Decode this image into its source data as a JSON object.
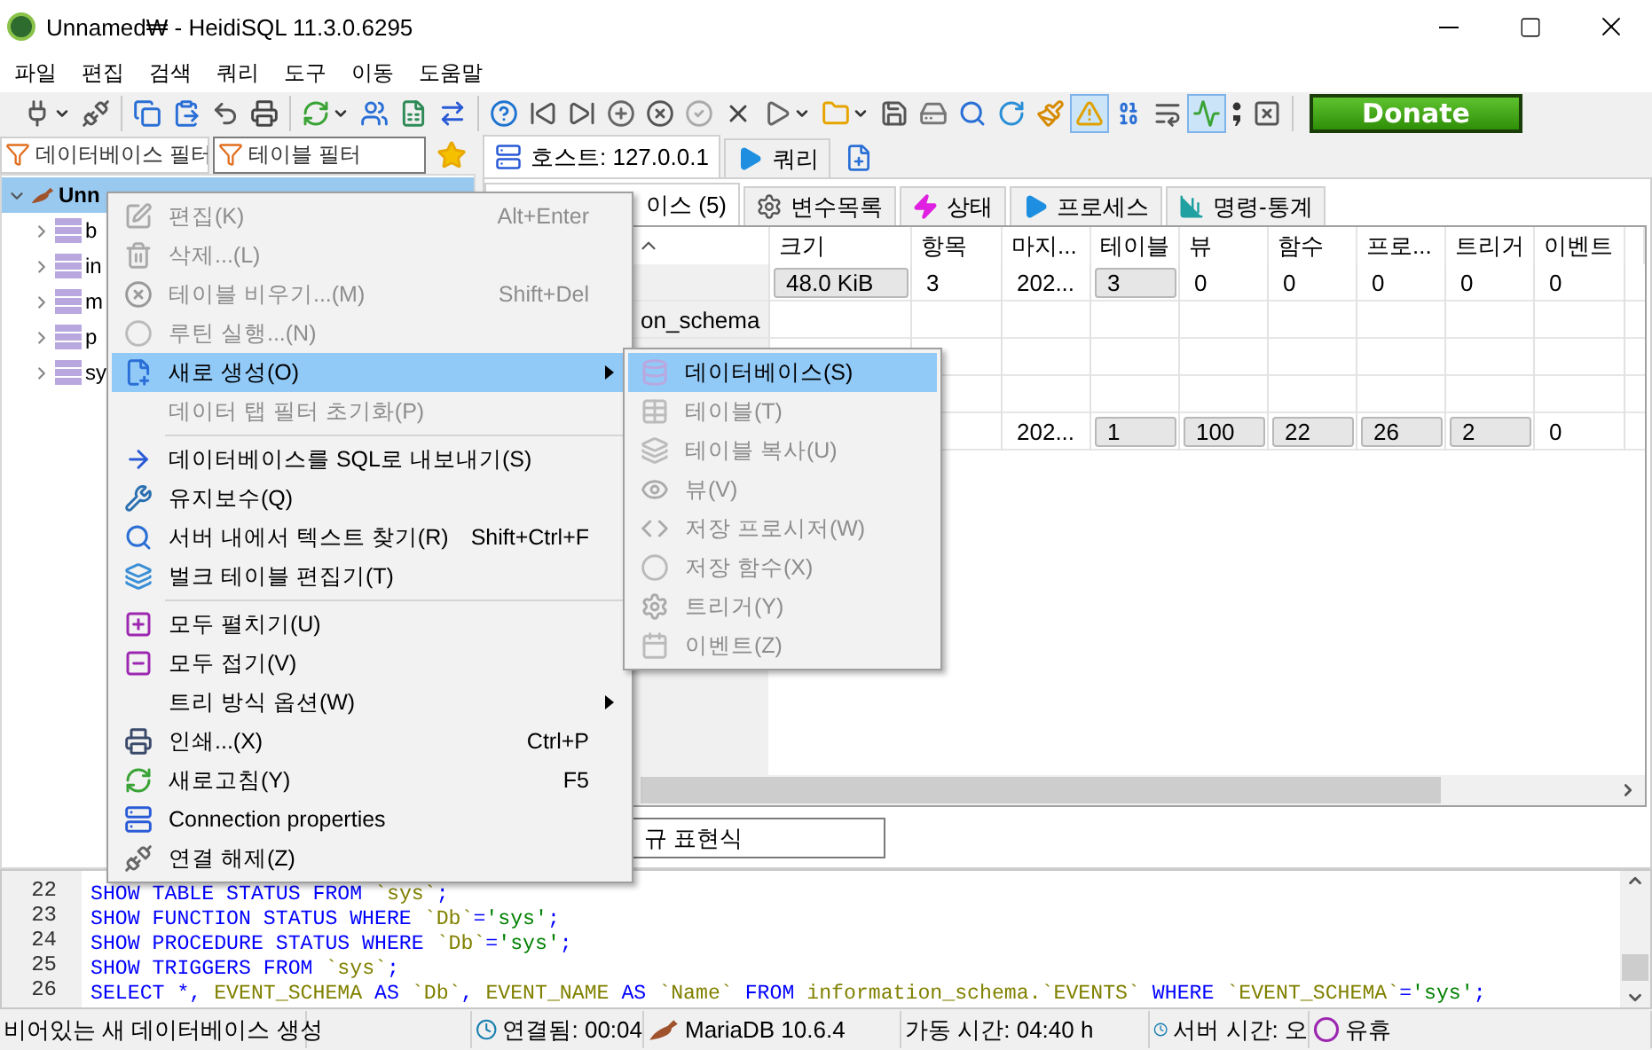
{
  "window": {
    "title": "Unnamed₩ - HeidiSQL 11.3.0.6295"
  },
  "menu_bar": [
    "파일",
    "편집",
    "검색",
    "쿼리",
    "도구",
    "이동",
    "도움말"
  ],
  "toolbar": {
    "buttons": [
      {
        "kind": "split",
        "pressed": false
      },
      {
        "kind": "button",
        "pressed": false
      },
      {
        "kind": "separator"
      },
      {
        "kind": "button",
        "pressed": false
      },
      {
        "kind": "button",
        "pressed": false
      },
      {
        "kind": "button",
        "pressed": false
      },
      {
        "kind": "button",
        "pressed": false
      },
      {
        "kind": "separator"
      },
      {
        "kind": "split",
        "pressed": false
      },
      {
        "kind": "button",
        "pressed": false
      },
      {
        "kind": "button",
        "pressed": false
      },
      {
        "kind": "button",
        "pressed": false
      },
      {
        "kind": "separator"
      },
      {
        "kind": "button",
        "pressed": false
      },
      {
        "kind": "button",
        "pressed": false
      },
      {
        "kind": "button",
        "pressed": false
      },
      {
        "kind": "button",
        "pressed": false
      },
      {
        "kind": "button",
        "pressed": false
      },
      {
        "kind": "button",
        "pressed": false
      },
      {
        "kind": "button",
        "pressed": false
      },
      {
        "kind": "split",
        "pressed": false
      },
      {
        "kind": "split",
        "pressed": false
      },
      {
        "kind": "button",
        "pressed": false
      },
      {
        "kind": "button",
        "pressed": false
      },
      {
        "kind": "button",
        "pressed": false
      },
      {
        "kind": "button",
        "pressed": false
      },
      {
        "kind": "button",
        "pressed": false
      },
      {
        "kind": "button",
        "pressed": true
      },
      {
        "kind": "button",
        "pressed": false
      },
      {
        "kind": "button",
        "pressed": false
      },
      {
        "kind": "button",
        "pressed": true
      },
      {
        "kind": "button",
        "pressed": false
      },
      {
        "kind": "button",
        "pressed": false
      },
      {
        "kind": "separator"
      }
    ],
    "donate": "Donate"
  },
  "db_filter": {
    "placeholder": "데이터베이스 필터"
  },
  "table_filter": {
    "placeholder": "테이블 필터"
  },
  "tree": [
    {
      "label": "Unn",
      "expanded": true,
      "selected": true,
      "children": [
        {
          "label": "b",
          "expanded": false,
          "selected": false
        },
        {
          "label": "in",
          "expanded": false,
          "selected": false
        },
        {
          "label": "m",
          "expanded": false,
          "selected": false
        },
        {
          "label": "p",
          "expanded": false,
          "selected": false
        },
        {
          "label": "sy",
          "expanded": false,
          "selected": false
        }
      ]
    }
  ],
  "host_tabs": [
    {
      "label": "호스트: 127.0.0.1",
      "selected": true
    },
    {
      "label": "쿼리",
      "selected": false
    }
  ],
  "sub_tabs": [
    {
      "label": "이스 (5)",
      "selected": true
    },
    {
      "label": "변수목록",
      "selected": false
    },
    {
      "label": "상태",
      "selected": false
    },
    {
      "label": "프로세스",
      "selected": false
    },
    {
      "label": "명령-통계",
      "selected": false
    }
  ],
  "table": {
    "name_column": {
      "sorted": true
    },
    "columns": [
      "크기",
      "항목",
      "마지...",
      "테이블",
      "뷰",
      "함수",
      "프로...",
      "트리거",
      "이벤트"
    ],
    "rows": [
      {
        "cells": [
          {
            "text": "48.0 KiB",
            "bar": true
          },
          "3",
          "202...",
          {
            "text": "3",
            "bar": true
          },
          "0",
          "0",
          "0",
          "0",
          "0"
        ]
      },
      {
        "name": "on_schema"
      },
      {},
      {},
      {
        "cells": [
          null,
          null,
          "202...",
          {
            "text": "1",
            "bar": true
          },
          {
            "text": "100",
            "bar": true
          },
          {
            "text": "22",
            "bar": true
          },
          {
            "text": "26",
            "bar": true
          },
          {
            "text": "2",
            "bar": true
          },
          "0"
        ]
      }
    ]
  },
  "grid_filter": {
    "placeholder": "규 표현식"
  },
  "context_menu": {
    "items": [
      {
        "kind": "item",
        "label": "편집(K)",
        "shortcut": "Alt+Enter",
        "disabled": true,
        "selected": false
      },
      {
        "kind": "item",
        "label": "삭제...(L)",
        "disabled": true,
        "selected": false
      },
      {
        "kind": "item",
        "label": "테이블 비우기...(M)",
        "shortcut": "Shift+Del",
        "disabled": true,
        "selected": false
      },
      {
        "kind": "item",
        "label": "루틴 실행...(N)",
        "disabled": true,
        "selected": false
      },
      {
        "kind": "item",
        "label": "새로 생성(O)",
        "disabled": false,
        "selected": true,
        "submenu": true
      },
      {
        "kind": "item",
        "label": "데이터 탭 필터 초기화(P)",
        "disabled": true,
        "selected": false
      },
      {
        "kind": "separator"
      },
      {
        "kind": "item",
        "label": "데이터베이스를 SQL로 내보내기(S)",
        "disabled": false,
        "selected": false
      },
      {
        "kind": "item",
        "label": "유지보수(Q)",
        "disabled": false,
        "selected": false
      },
      {
        "kind": "item",
        "label": "서버 내에서 텍스트 찾기(R)",
        "shortcut": "Shift+Ctrl+F",
        "disabled": false,
        "selected": false
      },
      {
        "kind": "item",
        "label": "벌크 테이블 편집기(T)",
        "disabled": false,
        "selected": false
      },
      {
        "kind": "separator"
      },
      {
        "kind": "item",
        "label": "모두 펼치기(U)",
        "disabled": false,
        "selected": false
      },
      {
        "kind": "item",
        "label": "모두 접기(V)",
        "disabled": false,
        "selected": false
      },
      {
        "kind": "item",
        "label": "트리 방식 옵션(W)",
        "disabled": false,
        "selected": false,
        "submenu": true
      },
      {
        "kind": "item",
        "label": "인쇄...(X)",
        "shortcut": "Ctrl+P",
        "disabled": false,
        "selected": false
      },
      {
        "kind": "item",
        "label": "새로고침(Y)",
        "shortcut": "F5",
        "disabled": false,
        "selected": false
      },
      {
        "kind": "item",
        "label": "Connection properties",
        "disabled": false,
        "selected": false
      },
      {
        "kind": "item",
        "label": "연결 해제(Z)",
        "disabled": false,
        "selected": false
      }
    ]
  },
  "submenu": {
    "items": [
      {
        "label": "데이터베이스(S)",
        "disabled": false,
        "selected": true
      },
      {
        "label": "테이블(T)",
        "disabled": true,
        "selected": false
      },
      {
        "label": "테이블 복사(U)",
        "disabled": true,
        "selected": false
      },
      {
        "label": "뷰(V)",
        "disabled": true,
        "selected": false
      },
      {
        "label": "저장 프로시저(W)",
        "disabled": true,
        "selected": false
      },
      {
        "label": "저장 함수(X)",
        "disabled": true,
        "selected": false
      },
      {
        "label": "트리거(Y)",
        "disabled": true,
        "selected": false
      },
      {
        "label": "이벤트(Z)",
        "disabled": true,
        "selected": false
      }
    ]
  },
  "query_log": [
    {
      "number": "22",
      "tokens": [
        {
          "kind": "keyword",
          "text": "SHOW TABLE STATUS FROM "
        },
        {
          "kind": "identifier",
          "text": "`sys`"
        },
        {
          "kind": "keyword",
          "text": ";"
        }
      ]
    },
    {
      "number": "23",
      "tokens": [
        {
          "kind": "keyword",
          "text": "SHOW FUNCTION STATUS WHERE "
        },
        {
          "kind": "identifier",
          "text": "`Db`"
        },
        {
          "kind": "keyword",
          "text": "="
        },
        {
          "kind": "string",
          "text": "'sys'"
        },
        {
          "kind": "keyword",
          "text": ";"
        }
      ]
    },
    {
      "number": "24",
      "tokens": [
        {
          "kind": "keyword",
          "text": "SHOW PROCEDURE STATUS WHERE "
        },
        {
          "kind": "identifier",
          "text": "`Db`"
        },
        {
          "kind": "keyword",
          "text": "="
        },
        {
          "kind": "string",
          "text": "'sys'"
        },
        {
          "kind": "keyword",
          "text": ";"
        }
      ]
    },
    {
      "number": "25",
      "tokens": [
        {
          "kind": "keyword",
          "text": "SHOW TRIGGERS FROM "
        },
        {
          "kind": "identifier",
          "text": "`sys`"
        },
        {
          "kind": "keyword",
          "text": ";"
        }
      ]
    },
    {
      "number": "26",
      "tokens": [
        {
          "kind": "keyword",
          "text": "SELECT *, "
        },
        {
          "kind": "identifier",
          "text": "EVENT_SCHEMA"
        },
        {
          "kind": "keyword",
          "text": " AS "
        },
        {
          "kind": "identifier",
          "text": "`Db`"
        },
        {
          "kind": "keyword",
          "text": ", "
        },
        {
          "kind": "identifier",
          "text": "EVENT_NAME"
        },
        {
          "kind": "keyword",
          "text": " AS "
        },
        {
          "kind": "identifier",
          "text": "`Name`"
        },
        {
          "kind": "keyword",
          "text": " FROM "
        },
        {
          "kind": "identifier",
          "text": "information_schema.`EVENTS`"
        },
        {
          "kind": "keyword",
          "text": " WHERE "
        },
        {
          "kind": "identifier",
          "text": "`EVENT_SCHEMA`"
        },
        {
          "kind": "keyword",
          "text": "="
        },
        {
          "kind": "string",
          "text": "'sys'"
        },
        {
          "kind": "keyword",
          "text": ";"
        }
      ]
    }
  ],
  "status_bar": [
    "비어있는 새 데이터베이스 생성",
    "연결됨: 00:04",
    "MariaDB 10.6.4",
    "가동 시간: 04:40 h",
    "서버 시간: 오",
    "유휴"
  ]
}
